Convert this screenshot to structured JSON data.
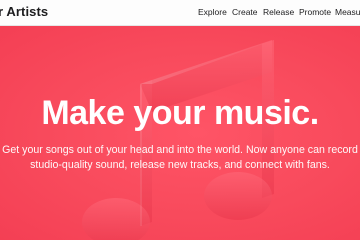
{
  "nav": {
    "brand": "r Artists",
    "links": [
      "Explore",
      "Create",
      "Release",
      "Promote",
      "Measure"
    ]
  },
  "hero": {
    "headline": "Make your music.",
    "subline_1": "Get your songs out of your head and into the world. Now anyone can record",
    "subline_2": "studio-quality sound, release new tracks, and connect with fans."
  },
  "colors": {
    "hero_background": "#f84a5c",
    "nav_background": "#fdfdfd"
  },
  "icons": {
    "hero_graphic": "music-note-icon"
  }
}
